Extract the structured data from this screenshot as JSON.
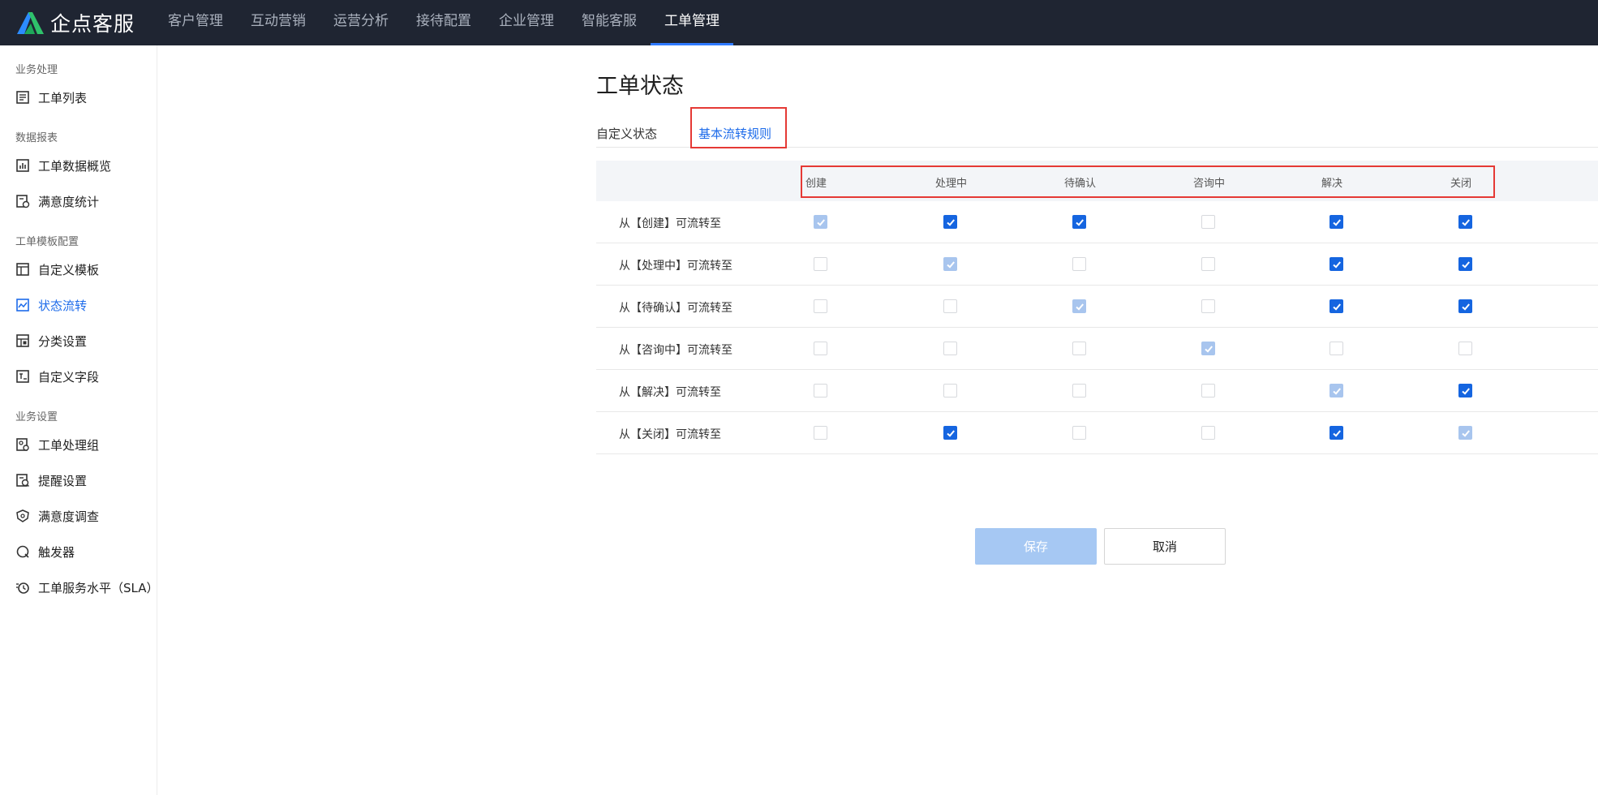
{
  "app": {
    "logo_text": "企点客服"
  },
  "nav": [
    "客户管理",
    "互动营销",
    "运营分析",
    "接待配置",
    "企业管理",
    "智能客服",
    "工单管理"
  ],
  "nav_active_index": 6,
  "sidebar": {
    "groups": [
      {
        "title": "业务处理",
        "items": [
          {
            "label": "工单列表",
            "icon": "list-icon"
          }
        ]
      },
      {
        "title": "数据报表",
        "items": [
          {
            "label": "工单数据概览",
            "icon": "bar-chart-icon"
          },
          {
            "label": "满意度统计",
            "icon": "satisfaction-chart-icon"
          }
        ]
      },
      {
        "title": "工单模板配置",
        "items": [
          {
            "label": "自定义模板",
            "icon": "template-icon"
          },
          {
            "label": "状态流转",
            "icon": "flow-chart-icon",
            "active": true
          },
          {
            "label": "分类设置",
            "icon": "category-icon"
          },
          {
            "label": "自定义字段",
            "icon": "field-icon"
          }
        ]
      },
      {
        "title": "业务设置",
        "items": [
          {
            "label": "工单处理组",
            "icon": "group-icon"
          },
          {
            "label": "提醒设置",
            "icon": "reminder-icon"
          },
          {
            "label": "满意度调查",
            "icon": "survey-icon"
          },
          {
            "label": "触发器",
            "icon": "trigger-icon"
          },
          {
            "label": "工单服务水平（SLA）",
            "icon": "sla-clock-icon"
          }
        ]
      }
    ]
  },
  "page": {
    "title": "工单状态",
    "tabs": [
      "自定义状态",
      "基本流转规则"
    ],
    "active_tab": 1
  },
  "table": {
    "columns": [
      "创建",
      "处理中",
      "待确认",
      "咨询中",
      "解决",
      "关闭"
    ],
    "rows": [
      {
        "label": "从【创建】可流转至",
        "cells": [
          "disabled",
          "checked",
          "checked",
          "unchecked",
          "checked",
          "checked"
        ]
      },
      {
        "label": "从【处理中】可流转至",
        "cells": [
          "unchecked",
          "disabled",
          "unchecked",
          "unchecked",
          "checked",
          "checked"
        ]
      },
      {
        "label": "从【待确认】可流转至",
        "cells": [
          "unchecked",
          "unchecked",
          "disabled",
          "unchecked",
          "checked",
          "checked"
        ]
      },
      {
        "label": "从【咨询中】可流转至",
        "cells": [
          "unchecked",
          "unchecked",
          "unchecked",
          "disabled",
          "unchecked",
          "unchecked"
        ]
      },
      {
        "label": "从【解决】可流转至",
        "cells": [
          "unchecked",
          "unchecked",
          "unchecked",
          "unchecked",
          "disabled",
          "checked"
        ]
      },
      {
        "label": "从【关闭】可流转至",
        "cells": [
          "unchecked",
          "checked",
          "unchecked",
          "unchecked",
          "checked",
          "disabled"
        ]
      }
    ]
  },
  "actions": {
    "save": "保存",
    "cancel": "取消"
  },
  "colors": {
    "accent": "#1d6bea",
    "topbar": "#1f2532",
    "highlight": "#e53935"
  }
}
